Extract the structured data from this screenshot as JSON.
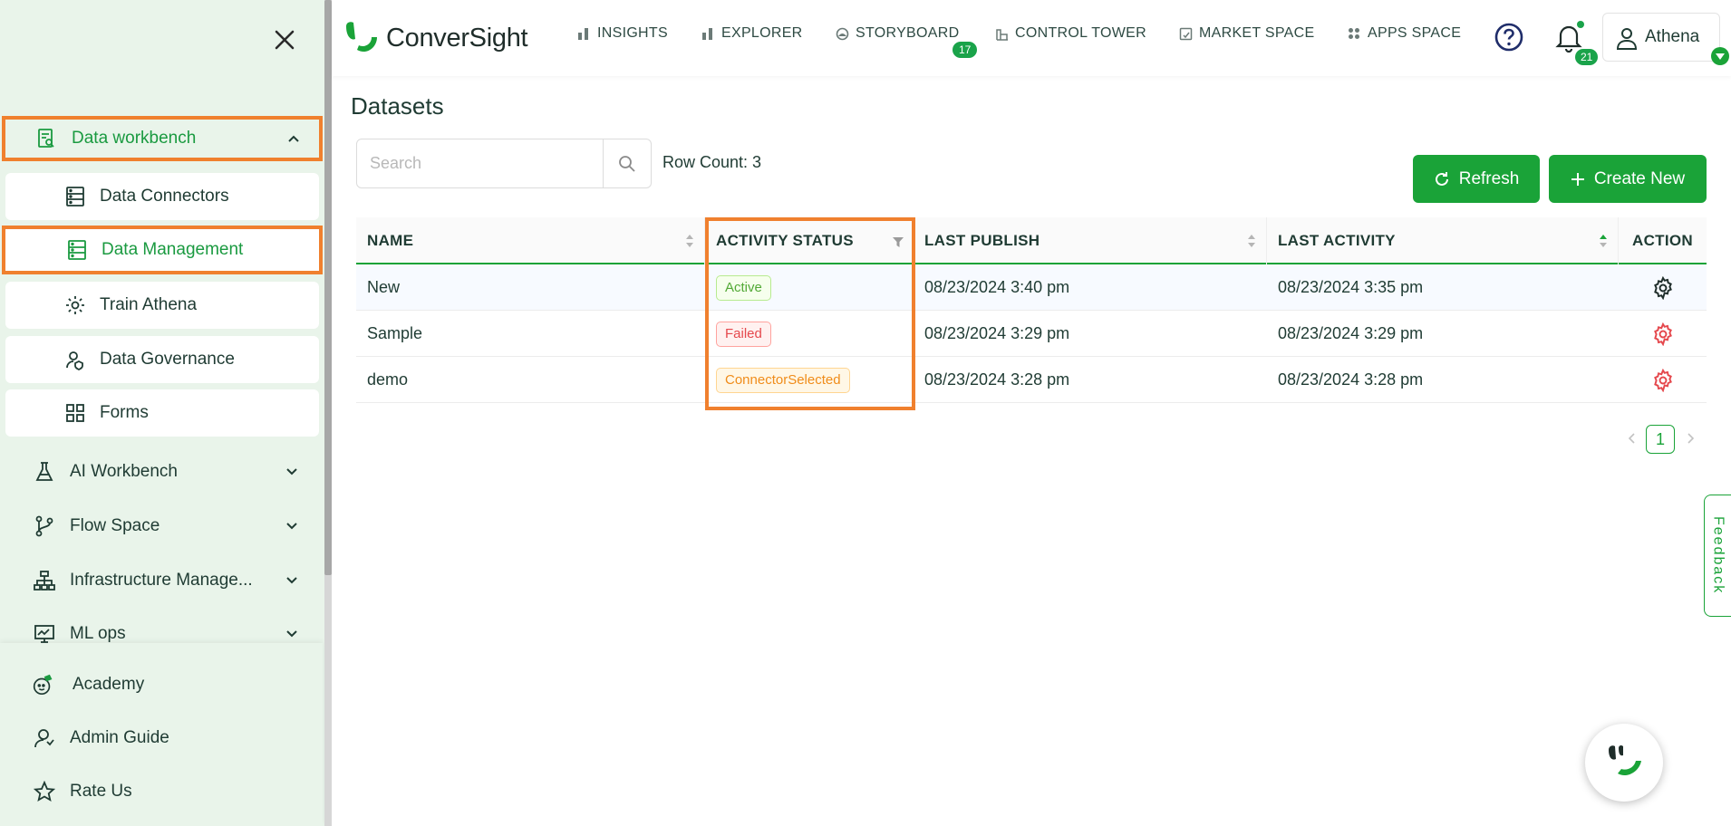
{
  "sidebar": {
    "close_label": "",
    "data_workbench": "Data workbench",
    "sub_items": [
      "Data Connectors",
      "Data Management",
      "Train Athena",
      "Data Governance",
      "Forms"
    ],
    "groups": [
      "AI Workbench",
      "Flow Space",
      "Infrastructure Manage...",
      "ML ops"
    ],
    "bottom": [
      "Academy",
      "Admin Guide",
      "Rate Us"
    ]
  },
  "header": {
    "logo_text": "ConverSight",
    "nav": [
      "INSIGHTS",
      "EXPLORER",
      "STORYBOARD",
      "CONTROL TOWER",
      "MARKET SPACE",
      "APPS SPACE"
    ],
    "storyboard_badge": "17",
    "notif_badge": "21",
    "user_name": "Athena"
  },
  "main": {
    "title": "Datasets",
    "search_placeholder": "Search",
    "row_count": "Row Count: 3",
    "refresh_label": "Refresh",
    "create_label": "Create New"
  },
  "table": {
    "columns": [
      "NAME",
      "ACTIVITY STATUS",
      "LAST PUBLISH",
      "LAST ACTIVITY",
      "ACTION"
    ],
    "rows": [
      {
        "name": "New",
        "status": "Active",
        "last_publish": "08/23/2024 3:40 pm",
        "last_activity": "08/23/2024 3:35 pm"
      },
      {
        "name": "Sample",
        "status": "Failed",
        "last_publish": "08/23/2024 3:29 pm",
        "last_activity": "08/23/2024 3:29 pm"
      },
      {
        "name": "demo",
        "status": "ConnectorSelected",
        "last_publish": "08/23/2024 3:28 pm",
        "last_activity": "08/23/2024 3:28 pm"
      }
    ]
  },
  "pagination": {
    "current_page": "1"
  },
  "feedback_label": "Feedback",
  "colors": {
    "accent": "#1aa338",
    "highlight": "#f0802e",
    "sidebar_bg": "#e9f4ea"
  },
  "icons": {
    "close": "close-icon",
    "workbench": "data-workbench-icon",
    "connectors": "database-icon",
    "management": "database-icon",
    "train": "gear-icon",
    "governance": "user-shield-icon",
    "forms": "grid-icon",
    "ai": "flask-icon",
    "flow": "branch-icon",
    "infra": "hierarchy-icon",
    "mlops": "monitor-chart-icon",
    "academy": "academy-icon",
    "admin": "user-guide-icon",
    "rate": "star-icon"
  }
}
